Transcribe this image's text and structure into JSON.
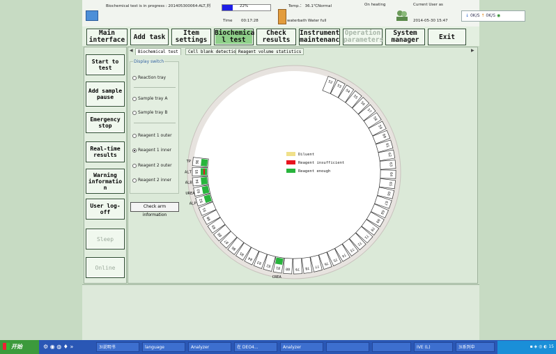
{
  "status": {
    "progress_text": "Biochemical test is in progress : 201405300064-ALT,刘",
    "progress_percent": 22,
    "progress_label": "22%",
    "time_label": "Time",
    "time_value": "00:17:28",
    "temp_text": "Temp.：  36.1℃Normal",
    "heating_text": "On heating",
    "water_text": "waterbath  Water full",
    "user_label": "Current User as",
    "datetime": "2014-05-30 15:47",
    "network": [
      "0K/S",
      "0K/S"
    ]
  },
  "nav": [
    {
      "line1": "Main",
      "line2": "interface"
    },
    {
      "line1": "Add task",
      "line2": ""
    },
    {
      "line1": "Item",
      "line2": "settings"
    },
    {
      "line1": "Biochemica",
      "line2": "l test"
    },
    {
      "line1": "Check",
      "line2": "results"
    },
    {
      "line1": "Instrument",
      "line2": "maintenanc"
    },
    {
      "line1": "Operation",
      "line2": "parameters"
    },
    {
      "line1": "System",
      "line2": "manager"
    },
    {
      "line1": "Exit",
      "line2": ""
    }
  ],
  "side": [
    {
      "label": "Start to test"
    },
    {
      "label": "Add sample pause"
    },
    {
      "label": "Emergency stop"
    },
    {
      "label": "Real-time results"
    },
    {
      "label": "Warning informatio n"
    },
    {
      "label": "User log-off"
    },
    {
      "label": "Sleep"
    },
    {
      "label": "Online"
    }
  ],
  "tabs": [
    "Biochemical test",
    "Cell blank detection",
    "Reagent volume statistics"
  ],
  "display_switch": {
    "title": "Display switch",
    "options": [
      "Reaction tray",
      "Sample tray A",
      "Sample tray B",
      "Reagent 1 outer",
      "Reagent 1 inner",
      "Reagent 2 outer",
      "Reagent 2 inner"
    ],
    "selected": "Reagent 1 inner"
  },
  "check_arm": "Check arm information",
  "legend": [
    {
      "label": "Diluent",
      "color": "#f0e08a"
    },
    {
      "label": "Reagent insufficient",
      "color": "#e8141e"
    },
    {
      "label": "Reagent enough",
      "color": "#28b43c"
    }
  ],
  "tray": {
    "positions": [
      "52",
      "53",
      "54",
      "55",
      "56",
      "57",
      "58",
      "59",
      "60",
      "61",
      "62",
      "63",
      "64",
      "65",
      "66",
      "67",
      "68",
      "69",
      "70",
      "71",
      "72",
      "73",
      "74",
      "75",
      "76",
      "77",
      "78",
      "79",
      "80",
      "81",
      "82",
      "83",
      "84",
      "85",
      "86",
      "87",
      "88",
      "89",
      "90",
      "91",
      "92",
      "93",
      "94",
      "95",
      "96"
    ],
    "assays": [
      {
        "pos": "92",
        "name": "ALP"
      },
      {
        "pos": "93",
        "name": "UREA"
      },
      {
        "pos": "94",
        "name": "ALB"
      },
      {
        "pos": "96",
        "name": "TP"
      },
      {
        "pos": "95",
        "name": "ALT"
      },
      {
        "pos": "81",
        "name": "CREA"
      }
    ]
  },
  "taskbar": {
    "start": "开始",
    "items": [
      "3I说明书",
      "language",
      "Analyzer",
      "在 DEO4...",
      "Analyzer",
      "",
      "",
      "",
      "IVE (L)",
      "3I系列中"
    ],
    "clock": "15"
  }
}
